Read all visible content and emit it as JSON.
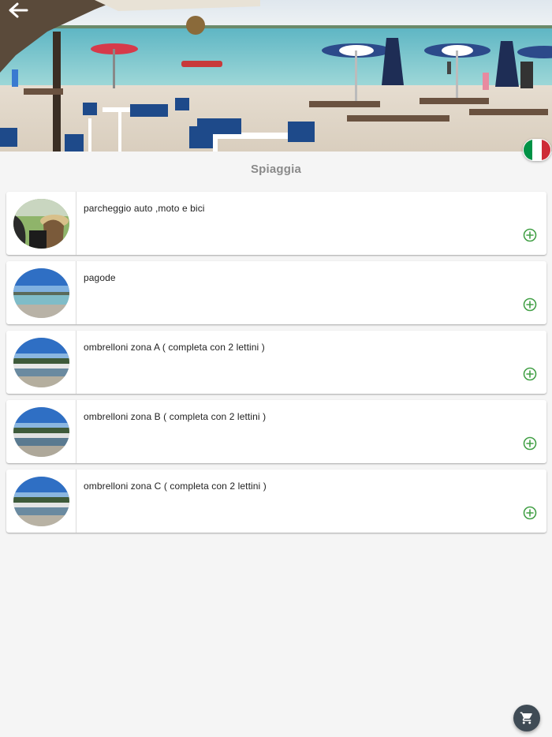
{
  "header": {
    "back_icon": "arrow-left-icon",
    "flag_colors": [
      "#009246",
      "#ffffff",
      "#ce2b37"
    ]
  },
  "section": {
    "title": "Spiaggia"
  },
  "items": [
    {
      "label": "parcheggio auto ,moto e bici",
      "thumb": "parking-photo",
      "action_icon": "add-circle-icon"
    },
    {
      "label": "pagode",
      "thumb": "beach-photo",
      "action_icon": "add-circle-icon"
    },
    {
      "label": "ombrelloni zona A ( completa con 2 lettini )",
      "thumb": "beach-umbrellas-photo",
      "action_icon": "add-circle-icon"
    },
    {
      "label": "ombrelloni zona B ( completa con 2 lettini )",
      "thumb": "beach-umbrellas-photo",
      "action_icon": "add-circle-icon"
    },
    {
      "label": "ombrelloni zona C ( completa con 2 lettini )",
      "thumb": "beach-umbrellas-photo",
      "action_icon": "add-circle-icon"
    }
  ],
  "cart": {
    "icon": "shopping-cart-icon"
  },
  "colors": {
    "accent_green": "#43a047",
    "fab": "#3f4b55",
    "title_gray": "#8a8a8a"
  }
}
